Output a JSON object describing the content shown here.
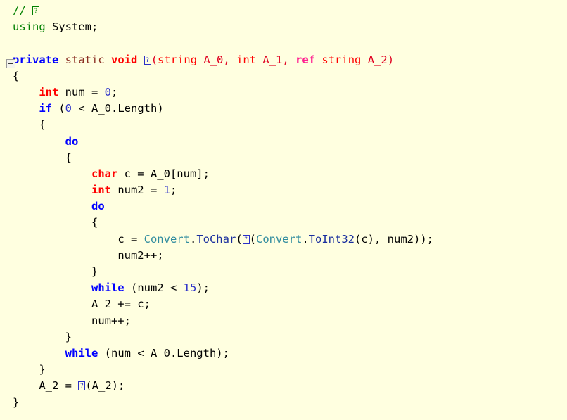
{
  "editor": {
    "name": "code-editor",
    "language": "C#",
    "background_color": "#ffffe0",
    "foreground_color": "#000000"
  },
  "colors": {
    "comment": "#008000",
    "keyword": "#0000ff",
    "type": "#ff0000",
    "static_modifier": "#8b2f23",
    "ref_modifier": "#ff2090",
    "parameter": "#e00020",
    "number": "#2b30c8",
    "class_name": "#2e8b9e",
    "method_name": "#1a2f9e",
    "identifier": "#000000",
    "fold_marker": "#9a9a9a"
  },
  "fold_markers": [
    {
      "line": 4,
      "type": "collapse-box",
      "state": "expanded"
    },
    {
      "line": 25,
      "type": "fold-end-line"
    }
  ],
  "missing_glyph_char": "?",
  "code": {
    "lines": [
      {
        "n": 1,
        "indent": 0,
        "tokens": [
          {
            "t": "comment",
            "v": "// "
          },
          {
            "t": "tofu-green",
            "v": "?"
          }
        ]
      },
      {
        "n": 2,
        "indent": 0,
        "tokens": [
          {
            "t": "keyword-green",
            "v": "using"
          },
          {
            "t": "plain",
            "v": " System;"
          }
        ]
      },
      {
        "n": 3,
        "indent": 0,
        "tokens": []
      },
      {
        "n": 4,
        "indent": 0,
        "tokens": [
          {
            "t": "keyword",
            "v": "private"
          },
          {
            "t": "plain",
            "v": " "
          },
          {
            "t": "static",
            "v": "static"
          },
          {
            "t": "plain",
            "v": " "
          },
          {
            "t": "type",
            "v": "void"
          },
          {
            "t": "plain",
            "v": " "
          },
          {
            "t": "tofu-blue",
            "v": "?"
          },
          {
            "t": "param",
            "v": "("
          },
          {
            "t": "typeplain",
            "v": "string"
          },
          {
            "t": "param",
            "v": " A_0, "
          },
          {
            "t": "typeplain",
            "v": "int"
          },
          {
            "t": "param",
            "v": " A_1, "
          },
          {
            "t": "ref",
            "v": "ref"
          },
          {
            "t": "param",
            "v": " "
          },
          {
            "t": "typeplain",
            "v": "string"
          },
          {
            "t": "param",
            "v": " A_2)"
          }
        ]
      },
      {
        "n": 5,
        "indent": 0,
        "tokens": [
          {
            "t": "plain",
            "v": "{"
          }
        ]
      },
      {
        "n": 6,
        "indent": 1,
        "tokens": [
          {
            "t": "type",
            "v": "int"
          },
          {
            "t": "plain",
            "v": " num = "
          },
          {
            "t": "number",
            "v": "0"
          },
          {
            "t": "plain",
            "v": ";"
          }
        ]
      },
      {
        "n": 7,
        "indent": 1,
        "tokens": [
          {
            "t": "keyword",
            "v": "if"
          },
          {
            "t": "plain",
            "v": " ("
          },
          {
            "t": "number",
            "v": "0"
          },
          {
            "t": "plain",
            "v": " < A_0.Length)"
          }
        ]
      },
      {
        "n": 8,
        "indent": 1,
        "tokens": [
          {
            "t": "plain",
            "v": "{"
          }
        ]
      },
      {
        "n": 9,
        "indent": 2,
        "tokens": [
          {
            "t": "keyword",
            "v": "do"
          }
        ]
      },
      {
        "n": 10,
        "indent": 2,
        "tokens": [
          {
            "t": "plain",
            "v": "{"
          }
        ]
      },
      {
        "n": 11,
        "indent": 3,
        "tokens": [
          {
            "t": "type",
            "v": "char"
          },
          {
            "t": "plain",
            "v": " c = A_0[num];"
          }
        ]
      },
      {
        "n": 12,
        "indent": 3,
        "tokens": [
          {
            "t": "type",
            "v": "int"
          },
          {
            "t": "plain",
            "v": " num2 = "
          },
          {
            "t": "number",
            "v": "1"
          },
          {
            "t": "plain",
            "v": ";"
          }
        ]
      },
      {
        "n": 13,
        "indent": 3,
        "tokens": [
          {
            "t": "keyword",
            "v": "do"
          }
        ]
      },
      {
        "n": 14,
        "indent": 3,
        "tokens": [
          {
            "t": "plain",
            "v": "{"
          }
        ]
      },
      {
        "n": 15,
        "indent": 4,
        "tokens": [
          {
            "t": "plain",
            "v": "c = "
          },
          {
            "t": "class",
            "v": "Convert"
          },
          {
            "t": "plain",
            "v": "."
          },
          {
            "t": "method",
            "v": "ToChar"
          },
          {
            "t": "plain",
            "v": "("
          },
          {
            "t": "tofu-blue",
            "v": "?"
          },
          {
            "t": "plain",
            "v": "("
          },
          {
            "t": "class",
            "v": "Convert"
          },
          {
            "t": "plain",
            "v": "."
          },
          {
            "t": "method",
            "v": "ToInt32"
          },
          {
            "t": "plain",
            "v": "(c), num2));"
          }
        ]
      },
      {
        "n": 16,
        "indent": 4,
        "tokens": [
          {
            "t": "plain",
            "v": "num2++;"
          }
        ]
      },
      {
        "n": 17,
        "indent": 3,
        "tokens": [
          {
            "t": "plain",
            "v": "}"
          }
        ]
      },
      {
        "n": 18,
        "indent": 3,
        "tokens": [
          {
            "t": "keyword",
            "v": "while"
          },
          {
            "t": "plain",
            "v": " (num2 < "
          },
          {
            "t": "number",
            "v": "15"
          },
          {
            "t": "plain",
            "v": ");"
          }
        ]
      },
      {
        "n": 19,
        "indent": 3,
        "tokens": [
          {
            "t": "plain",
            "v": "A_2 += c;"
          }
        ]
      },
      {
        "n": 20,
        "indent": 3,
        "tokens": [
          {
            "t": "plain",
            "v": "num++;"
          }
        ]
      },
      {
        "n": 21,
        "indent": 2,
        "tokens": [
          {
            "t": "plain",
            "v": "}"
          }
        ]
      },
      {
        "n": 22,
        "indent": 2,
        "tokens": [
          {
            "t": "keyword",
            "v": "while"
          },
          {
            "t": "plain",
            "v": " (num < A_0.Length);"
          }
        ]
      },
      {
        "n": 23,
        "indent": 1,
        "tokens": [
          {
            "t": "plain",
            "v": "}"
          }
        ]
      },
      {
        "n": 24,
        "indent": 1,
        "tokens": [
          {
            "t": "plain",
            "v": "A_2 = "
          },
          {
            "t": "tofu-blue",
            "v": "?"
          },
          {
            "t": "plain",
            "v": "(A_2);"
          }
        ]
      },
      {
        "n": 25,
        "indent": 0,
        "tokens": [
          {
            "t": "plain",
            "v": "}"
          }
        ]
      }
    ]
  }
}
